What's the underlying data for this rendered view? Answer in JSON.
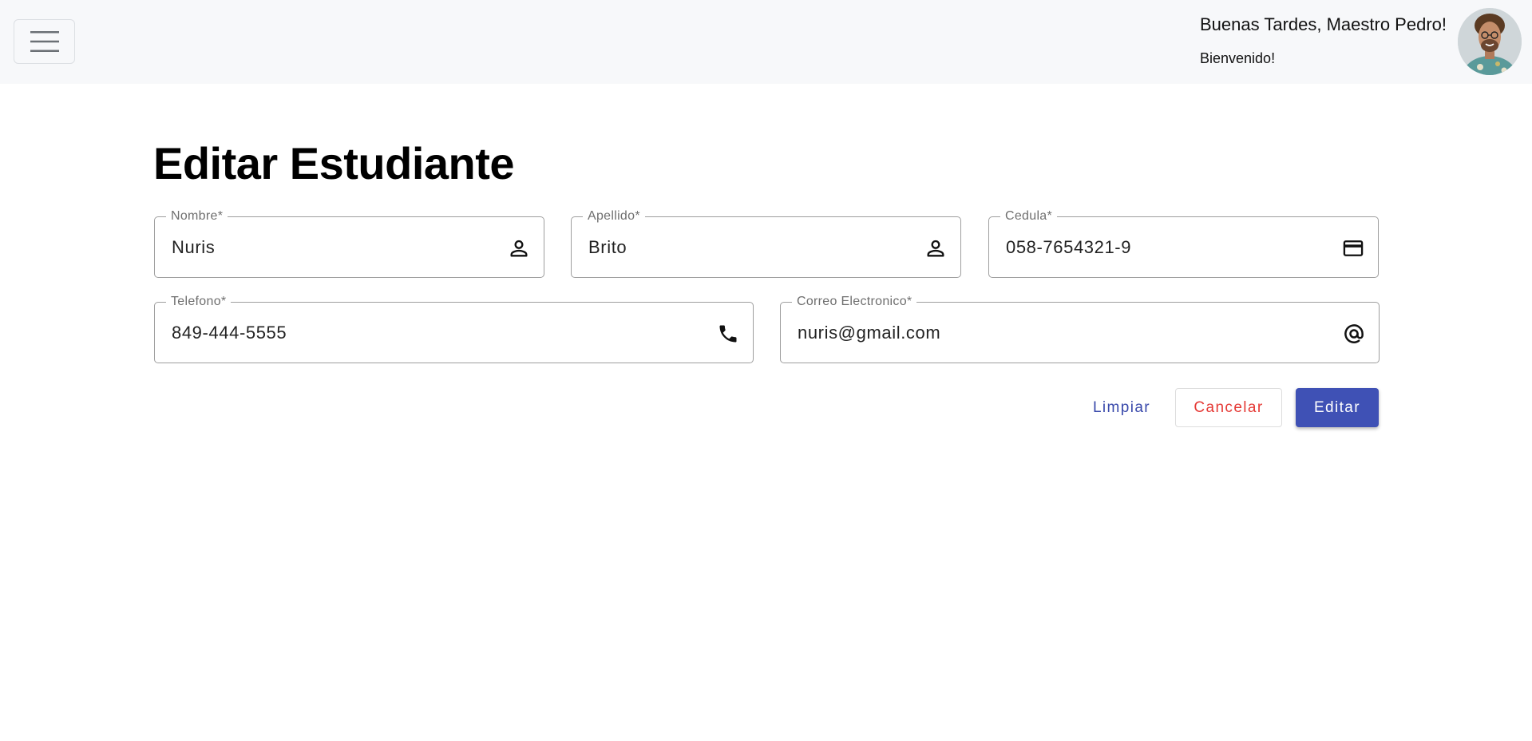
{
  "header": {
    "greeting": "Buenas Tardes, Maestro Pedro!",
    "welcome": "Bienvenido!",
    "menu_icon": "hamburger-menu-icon",
    "avatar_icon": "user-avatar"
  },
  "form": {
    "title": "Editar Estudiante",
    "fields": [
      {
        "label": "Nombre*",
        "value": "Nuris",
        "icon": "person-icon"
      },
      {
        "label": "Apellido*",
        "value": "Brito",
        "icon": "person-icon"
      },
      {
        "label": "Cedula*",
        "value": "058-7654321-9",
        "icon": "credit-card-icon"
      },
      {
        "label": "Telefono*",
        "value": "849-444-5555",
        "icon": "phone-icon"
      },
      {
        "label": "Correo Electronico*",
        "value": "nuris@gmail.com",
        "icon": "at-sign-icon"
      }
    ],
    "buttons": {
      "clear": "Limpiar",
      "cancel": "Cancelar",
      "edit": "Editar"
    }
  },
  "colors": {
    "primary": "#3f51b5",
    "primary_text": "#3949ab",
    "danger": "#e53935",
    "topbar_bg": "#f7f8fa",
    "field_border": "#9e9e9e"
  }
}
